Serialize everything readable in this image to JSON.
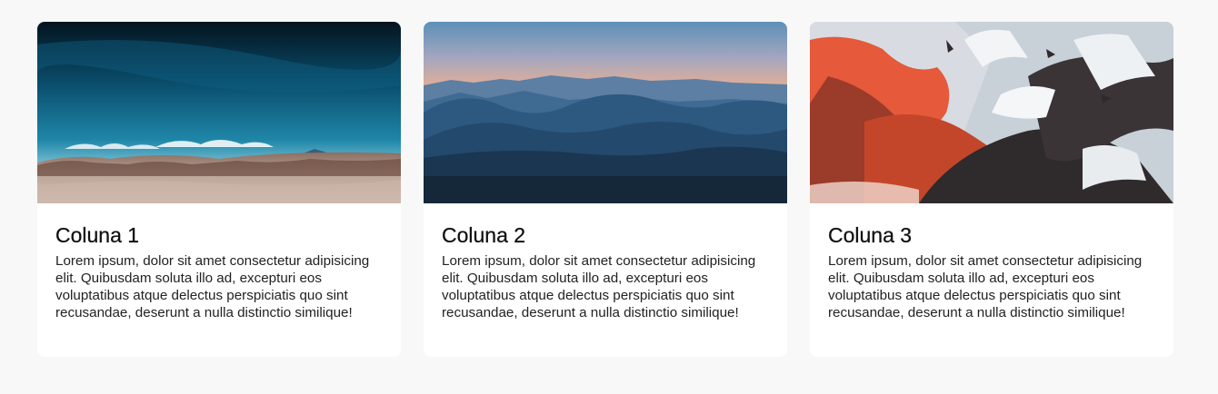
{
  "cards": [
    {
      "title": "Coluna 1",
      "text": "Lorem ipsum, dolor sit amet consectetur adipisicing elit. Quibusdam soluta illo ad, excepturi eos voluptatibus atque delectus perspiciatis quo sint recusandae, deserunt a nulla distinctio similique!",
      "image": "desert-landscape-photo"
    },
    {
      "title": "Coluna 2",
      "text": "Lorem ipsum, dolor sit amet consectetur adipisicing elit. Quibusdam soluta illo ad, excepturi eos voluptatibus atque delectus perspiciatis quo sint recusandae, deserunt a nulla distinctio similique!",
      "image": "mountain-sunset-photo"
    },
    {
      "title": "Coluna 3",
      "text": "Lorem ipsum, dolor sit amet consectetur adipisicing elit. Quibusdam soluta illo ad, excepturi eos voluptatibus atque delectus perspiciatis quo sint recusandae, deserunt a nulla distinctio similique!",
      "image": "snowy-volcanic-mountain-photo"
    }
  ]
}
